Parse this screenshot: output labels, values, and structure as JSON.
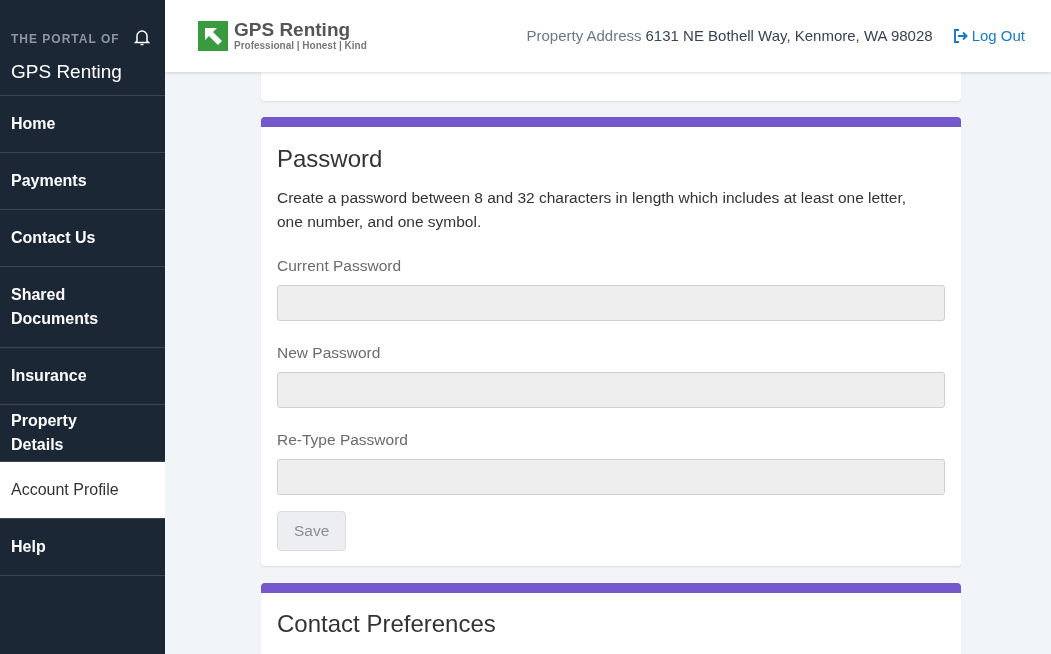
{
  "sidebar": {
    "eyebrow": "THE PORTAL OF",
    "title": "GPS Renting",
    "items": [
      {
        "label": "Home",
        "selected": false
      },
      {
        "label": "Payments",
        "selected": false
      },
      {
        "label": "Contact Us",
        "selected": false
      },
      {
        "label": "Shared Documents",
        "selected": false
      },
      {
        "label": "Insurance",
        "selected": false
      },
      {
        "label": "Property Details",
        "selected": false
      },
      {
        "label": "Account Profile",
        "selected": true
      },
      {
        "label": "Help",
        "selected": false
      }
    ]
  },
  "header": {
    "logo_name": "GPS Renting",
    "logo_tagline": "Professional | Honest | Kind",
    "address_label": "Property Address",
    "address": "6131 NE Bothell Way, Kenmore, WA 98028",
    "logout": "Log Out"
  },
  "password_card": {
    "title": "Password",
    "description": "Create a password between 8 and 32 characters in length which includes at least one letter, one number, and one symbol.",
    "fields": [
      {
        "label": "Current Password",
        "disabled": true
      },
      {
        "label": "New Password",
        "disabled": true
      },
      {
        "label": "Re-Type Password",
        "disabled": true
      }
    ],
    "save": {
      "label": "Save",
      "disabled": true
    }
  },
  "next_card": {
    "title": "Contact Preferences"
  }
}
